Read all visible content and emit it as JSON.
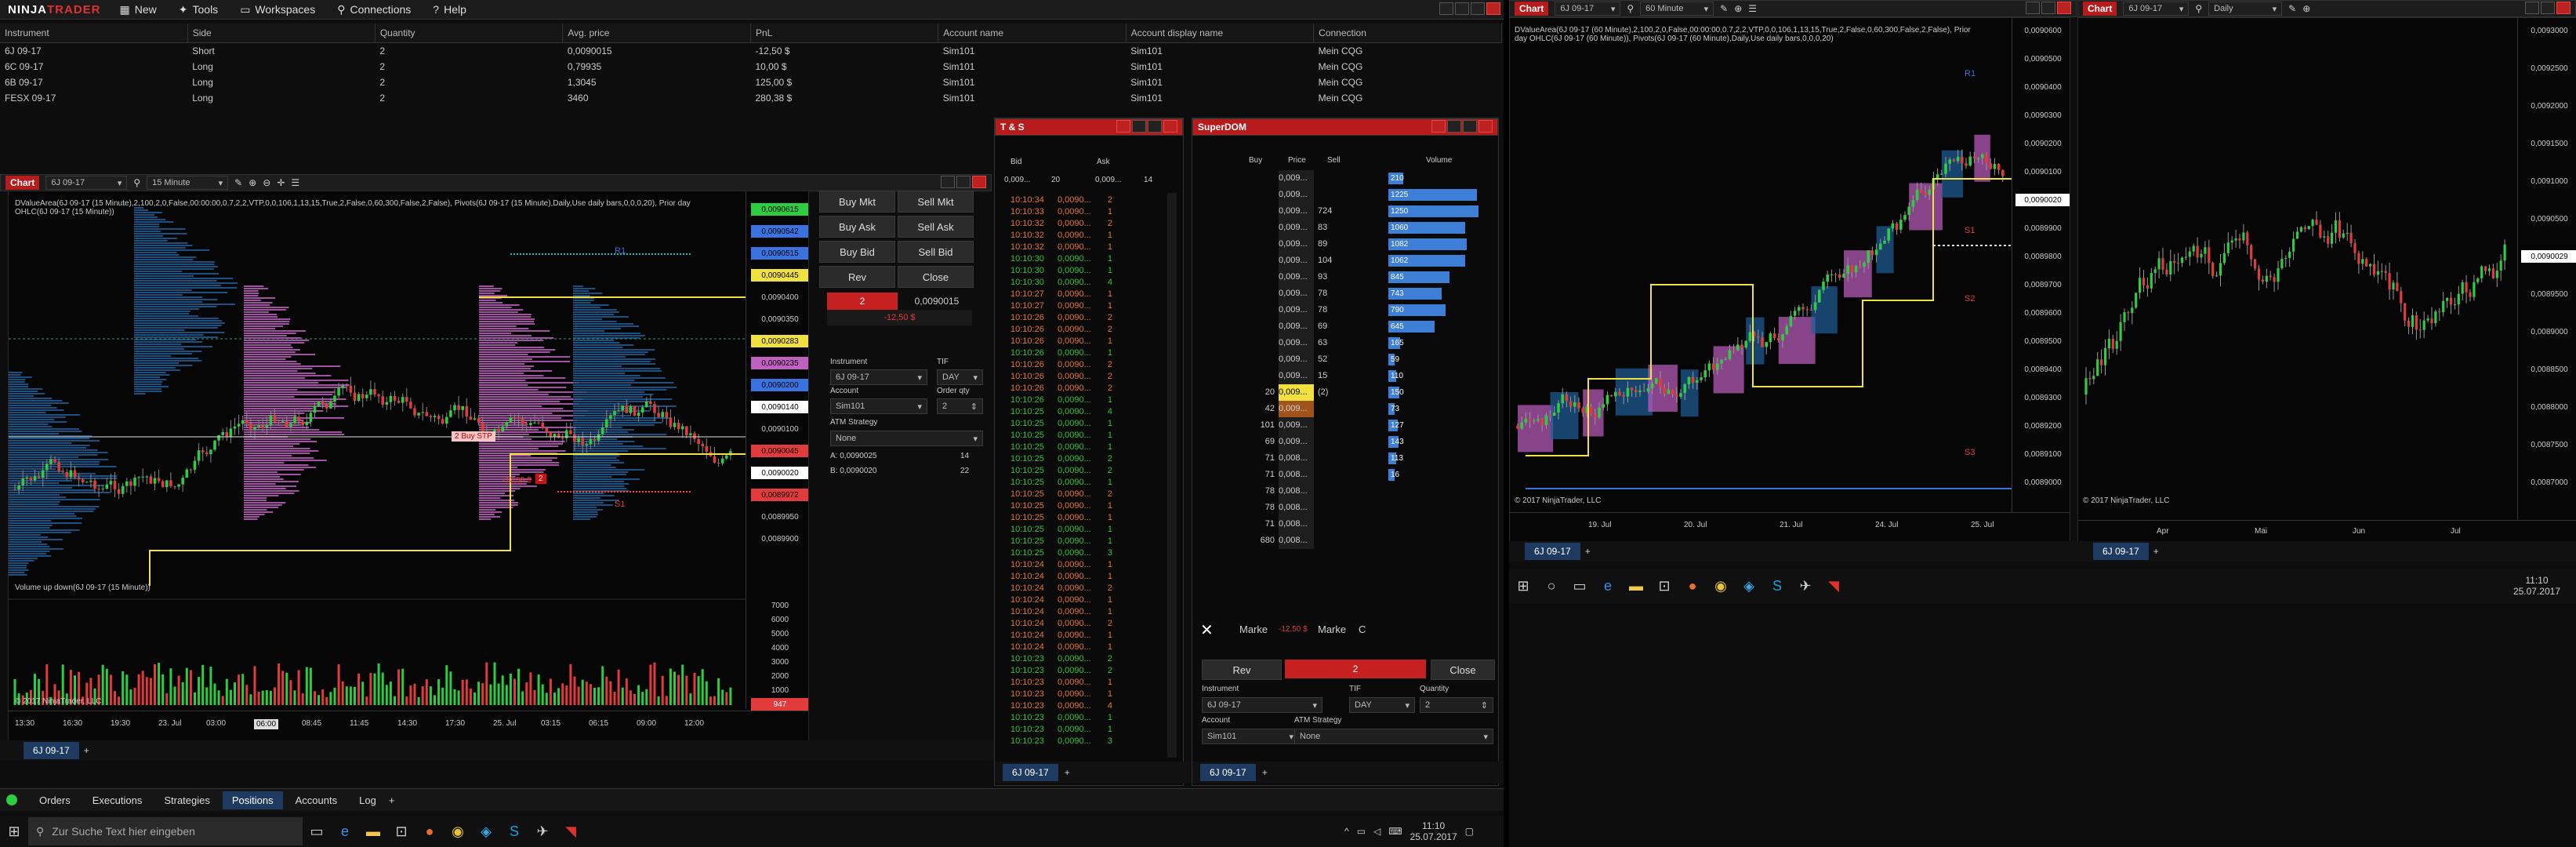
{
  "app": {
    "brand_a": "NINJA",
    "brand_b": "TRADER",
    "menu": [
      "New",
      "Tools",
      "Workspaces",
      "Connections",
      "Help"
    ]
  },
  "positions": {
    "headers": [
      "Instrument",
      "Side",
      "Quantity",
      "Avg. price",
      "PnL",
      "Account name",
      "Account display name",
      "Connection"
    ],
    "rows": [
      [
        "6J 09-17",
        "Short",
        "2",
        "0,0090015",
        "-12,50 $",
        "Sim101",
        "Sim101",
        "Mein CQG"
      ],
      [
        "6C 09-17",
        "Long",
        "2",
        "0,79935",
        "10,00 $",
        "Sim101",
        "Sim101",
        "Mein CQG"
      ],
      [
        "6B 09-17",
        "Long",
        "2",
        "1,3045",
        "125,00 $",
        "Sim101",
        "Sim101",
        "Mein CQG"
      ],
      [
        "FESX 09-17",
        "Long",
        "2",
        "3460",
        "280,38 $",
        "Sim101",
        "Sim101",
        "Mein CQG"
      ]
    ]
  },
  "chart1": {
    "title": "Chart",
    "instrument": "6J 09-17",
    "interval": "15 Minute",
    "indicator_text": "DValueArea(6J 09-17 (15 Minute),2,100,2,0,False,00:00:00,0.7,2,2,VTP,0,0,106,1,13,15,True,2,False,0,60,300,False,2,False), Pivots(6J 09-17 (15 Minute),Daily,Use daily bars,0,0,0,20), Prior day OHLC(6J 09-17 (15 Minute))",
    "volume_title": "Volume up down(6J 09-17 (15 Minute))",
    "copyright": "© 2017 NinjaTrader, LLC",
    "price_labels": [
      "0,0090615",
      "0,0090542",
      "0,0090515",
      "0,0090445",
      "0,0090400",
      "0,0090350",
      "0,0090283",
      "0,0090235",
      "0,0090200",
      "0,0090140",
      "0,0090100",
      "0,0090045",
      "0,0090020",
      "0,0089972",
      "0,0089950",
      "0,0089900"
    ],
    "vol_labels": [
      "7000",
      "6000",
      "5000",
      "4000",
      "3000",
      "2000",
      "1000",
      "947"
    ],
    "time_labels": [
      "13:30",
      "16:30",
      "19:30",
      "23. Jul",
      "03:00",
      "06:00",
      "08:45",
      "11:45",
      "14:30",
      "17:30",
      "25. Jul",
      "03:15",
      "06:15",
      "09:00",
      "12:00"
    ],
    "buy_stop": "2  Buy STP",
    "pnl_tag": "-12,50 $",
    "pnl_qty": "2",
    "r1": "R1",
    "s1": "S1",
    "tab": "6J 09-17"
  },
  "order_entry": {
    "buttons": [
      "Buy Mkt",
      "Sell Mkt",
      "Buy Ask",
      "Sell Ask",
      "Buy Bid",
      "Sell Bid",
      "Rev",
      "Close"
    ],
    "position_qty": "2",
    "position_price": "0,0090015",
    "pnl": "-12,50 $",
    "instrument_label": "Instrument",
    "instrument_value": "6J 09-17",
    "tif_label": "TIF",
    "tif_value": "DAY",
    "account_label": "Account",
    "account_value": "Sim101",
    "qty_label": "Order qty",
    "qty_value": "2",
    "atm_label": "ATM Strategy",
    "atm_value": "None",
    "a_label": "A: 0,0090025",
    "a_size": "14",
    "b_label": "B: 0,0090020",
    "b_size": "22"
  },
  "ts": {
    "title": "T & S",
    "bid_label": "Bid",
    "ask_label": "Ask",
    "bid_val": "0,009...",
    "bid_size": "20",
    "ask_val": "0,009...",
    "ask_size": "14",
    "tab": "6J 09-17",
    "rows": [
      [
        "10:10:34",
        "0,0090...",
        "2",
        "o"
      ],
      [
        "10:10:33",
        "0,0090...",
        "1",
        "o"
      ],
      [
        "10:10:32",
        "0,0090...",
        "2",
        "o"
      ],
      [
        "10:10:32",
        "0,0090...",
        "1",
        "o"
      ],
      [
        "10:10:32",
        "0,0090...",
        "1",
        "o"
      ],
      [
        "10:10:30",
        "0,0090...",
        "1",
        "g"
      ],
      [
        "10:10:30",
        "0,0090...",
        "1",
        "g"
      ],
      [
        "10:10:30",
        "0,0090...",
        "4",
        "g"
      ],
      [
        "10:10:27",
        "0,0090...",
        "1",
        "o"
      ],
      [
        "10:10:27",
        "0,0090...",
        "1",
        "o"
      ],
      [
        "10:10:26",
        "0,0090...",
        "2",
        "o"
      ],
      [
        "10:10:26",
        "0,0090...",
        "2",
        "o"
      ],
      [
        "10:10:26",
        "0,0090...",
        "1",
        "o"
      ],
      [
        "10:10:26",
        "0,0090...",
        "1",
        "g"
      ],
      [
        "10:10:26",
        "0,0090...",
        "2",
        "o"
      ],
      [
        "10:10:26",
        "0,0090...",
        "2",
        "o"
      ],
      [
        "10:10:26",
        "0,0090...",
        "2",
        "o"
      ],
      [
        "10:10:26",
        "0,0090...",
        "1",
        "g"
      ],
      [
        "10:10:25",
        "0,0090...",
        "4",
        "g"
      ],
      [
        "10:10:25",
        "0,0090...",
        "1",
        "g"
      ],
      [
        "10:10:25",
        "0,0090...",
        "1",
        "g"
      ],
      [
        "10:10:25",
        "0,0090...",
        "1",
        "g"
      ],
      [
        "10:10:25",
        "0,0090...",
        "2",
        "g"
      ],
      [
        "10:10:25",
        "0,0090...",
        "2",
        "g"
      ],
      [
        "10:10:25",
        "0,0090...",
        "1",
        "g"
      ],
      [
        "10:10:25",
        "0,0090...",
        "2",
        "o"
      ],
      [
        "10:10:25",
        "0,0090...",
        "1",
        "o"
      ],
      [
        "10:10:25",
        "0,0090...",
        "1",
        "o"
      ],
      [
        "10:10:25",
        "0,0090...",
        "1",
        "g"
      ],
      [
        "10:10:25",
        "0,0090...",
        "1",
        "g"
      ],
      [
        "10:10:25",
        "0,0090...",
        "3",
        "g"
      ],
      [
        "10:10:24",
        "0,0090...",
        "1",
        "o"
      ],
      [
        "10:10:24",
        "0,0090...",
        "1",
        "o"
      ],
      [
        "10:10:24",
        "0,0090...",
        "2",
        "o"
      ],
      [
        "10:10:24",
        "0,0090...",
        "1",
        "o"
      ],
      [
        "10:10:24",
        "0,0090...",
        "1",
        "o"
      ],
      [
        "10:10:24",
        "0,0090...",
        "2",
        "o"
      ],
      [
        "10:10:24",
        "0,0090...",
        "1",
        "o"
      ],
      [
        "10:10:24",
        "0,0090...",
        "1",
        "o"
      ],
      [
        "10:10:23",
        "0,0090...",
        "2",
        "g"
      ],
      [
        "10:10:23",
        "0,0090...",
        "2",
        "g"
      ],
      [
        "10:10:23",
        "0,0090...",
        "1",
        "o"
      ],
      [
        "10:10:23",
        "0,0090...",
        "1",
        "o"
      ],
      [
        "10:10:23",
        "0,0090...",
        "4",
        "o"
      ],
      [
        "10:10:23",
        "0,0090...",
        "1",
        "g"
      ],
      [
        "10:10:23",
        "0,0090...",
        "1",
        "g"
      ],
      [
        "10:10:23",
        "0,0090...",
        "3",
        "g"
      ]
    ]
  },
  "dom": {
    "title": "SuperDOM",
    "headers": [
      "Buy",
      "Price",
      "Sell",
      "Volume"
    ],
    "rows": [
      [
        "",
        "0,009...",
        "",
        "210"
      ],
      [
        "",
        "0,009...",
        "",
        "1225"
      ],
      [
        "",
        "0,009...",
        "724",
        "1250"
      ],
      [
        "",
        "0,009...",
        "83",
        "1060"
      ],
      [
        "",
        "0,009...",
        "89",
        "1082"
      ],
      [
        "",
        "0,009...",
        "104",
        "1062"
      ],
      [
        "",
        "0,009...",
        "93",
        "845"
      ],
      [
        "",
        "0,009...",
        "78",
        "743"
      ],
      [
        "",
        "0,009...",
        "78",
        "790"
      ],
      [
        "",
        "0,009...",
        "69",
        "645"
      ],
      [
        "",
        "0,009...",
        "63",
        "165"
      ],
      [
        "",
        "0,009...",
        "52",
        "59"
      ],
      [
        "",
        "0,009...",
        "15",
        "110"
      ],
      [
        "20",
        "0,009...",
        "(2)",
        "150"
      ],
      [
        "42",
        "0,009...",
        "",
        "73"
      ],
      [
        "101",
        "0,009...",
        "",
        "127"
      ],
      [
        "69",
        "0,009...",
        "",
        "143"
      ],
      [
        "71",
        "0,008...",
        "",
        "113"
      ],
      [
        "71",
        "0,008...",
        "",
        "16"
      ],
      [
        "78",
        "0,008...",
        "",
        ""
      ],
      [
        "78",
        "0,008...",
        "",
        ""
      ],
      [
        "71",
        "0,008...",
        "",
        ""
      ],
      [
        "680",
        "0,008...",
        "",
        ""
      ]
    ],
    "market_left": "Marke",
    "market_pnl": "-12,50 $",
    "market_right": "Marke",
    "c_label": "C",
    "rev": "Rev",
    "pos_qty": "2",
    "close": "Close",
    "instrument_label": "Instrument",
    "instrument_value": "6J 09-17",
    "tif_label": "TIF",
    "tif_value": "DAY",
    "qty_label": "Quantity",
    "qty_value": "2",
    "account_label": "Account",
    "account_value": "Sim101",
    "atm_label": "ATM Strategy",
    "atm_value": "None",
    "tab": "6J 09-17"
  },
  "bottom_tabs": {
    "tabs": [
      "Orders",
      "Executions",
      "Strategies",
      "Positions",
      "Accounts",
      "Log"
    ],
    "active": "Positions"
  },
  "taskbar1": {
    "search": "Zur Suche Text hier eingeben",
    "time": "11:10",
    "date": "25.07.2017"
  },
  "chart2": {
    "title": "Chart",
    "instrument": "6J 09-17",
    "interval": "60 Minute",
    "indicator_text": "DValueArea(6J 09-17 (60 Minute),2,100,2,0,False,00:00:00,0.7,2,2,VTP,0,0,106,1,13,15,True,2,False,0,60,300,False,2,False), Prior day OHLC(6J 09-17 (60 Minute)), Pivots(6J 09-17 (60 Minute),Daily,Use daily bars,0,0,0,20)",
    "copyright": "© 2017 NinjaTrader, LLC",
    "price_labels": [
      "0,0090600",
      "0,0090500",
      "0,0090400",
      "0,0090300",
      "0,0090200",
      "0,0090100",
      "0,0090020",
      "0,0089900",
      "0,0089800",
      "0,0089700",
      "0,0089600",
      "0,0089500",
      "0,0089400",
      "0,0089300",
      "0,0089200",
      "0,0089100",
      "0,0089000"
    ],
    "time_labels": [
      "19. Jul",
      "20. Jul",
      "21. Jul",
      "24. Jul",
      "25. Jul"
    ],
    "r1": "R1",
    "s1": "S1",
    "s2": "S2",
    "s3": "S3",
    "tab": "6J 09-17"
  },
  "chart3": {
    "title": "Chart",
    "instrument": "6J 09-17",
    "interval": "Daily",
    "copyright": "© 2017 NinjaTrader, LLC",
    "price_labels": [
      "0,0093000",
      "0,0092500",
      "0,0092000",
      "0,0091500",
      "0,0091000",
      "0,0090500",
      "0,0090029",
      "0,0089500",
      "0,0089000",
      "0,0088500",
      "0,0088000",
      "0,0087500",
      "0,0087000"
    ],
    "time_labels": [
      "Apr",
      "Mai",
      "Jun",
      "Jul"
    ],
    "tab": "6J 09-17"
  },
  "taskbar2": {
    "time": "11:10",
    "date": "25.07.2017"
  }
}
